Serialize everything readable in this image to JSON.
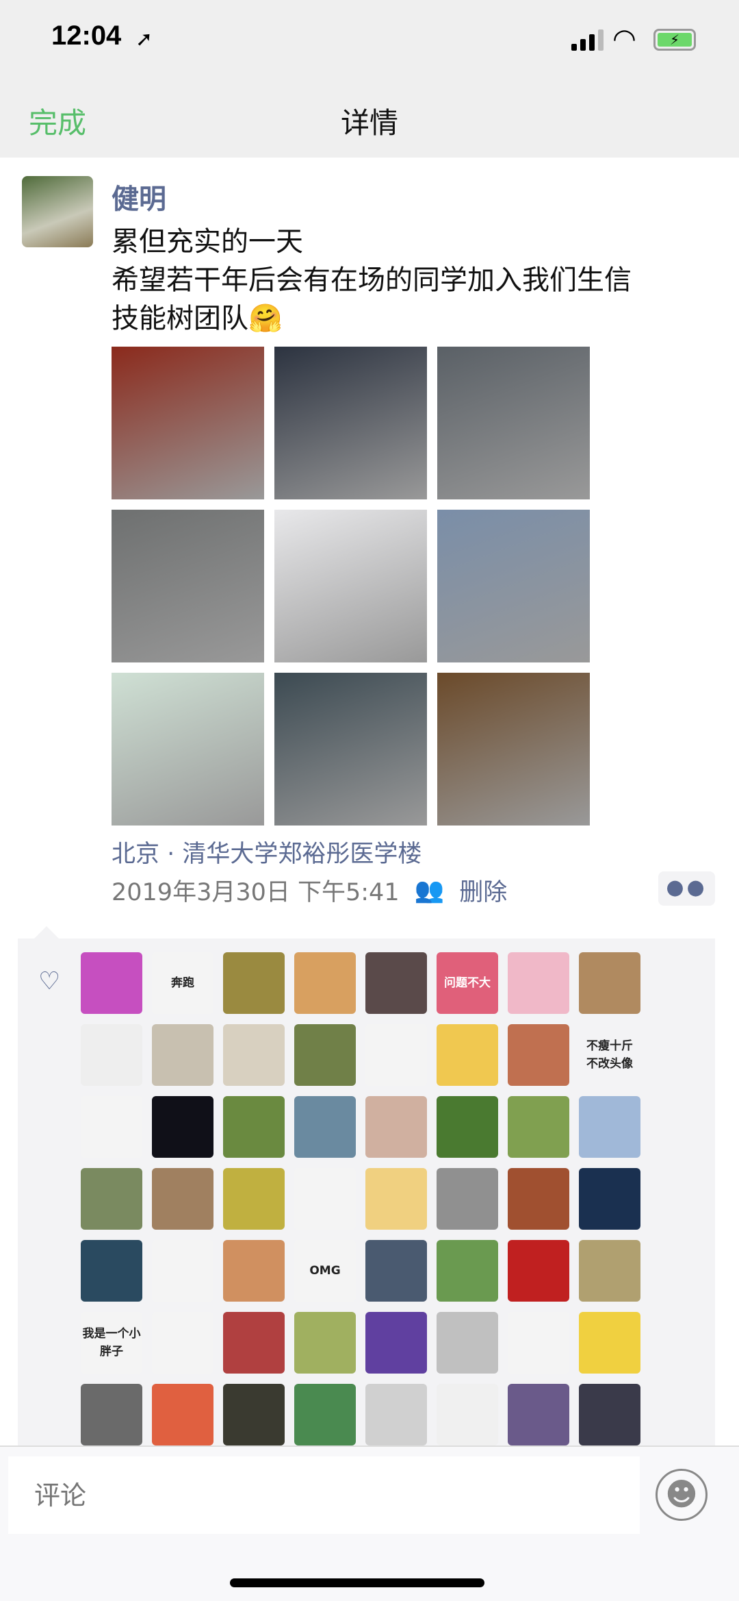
{
  "status_bar": {
    "time": "12:04",
    "location_icon": "location-arrow-icon",
    "wifi_icon": "wifi-icon",
    "battery_icon": "battery-charging-icon"
  },
  "nav": {
    "done_label": "完成",
    "title": "详情",
    "accent": "#57be6a"
  },
  "post": {
    "author": "健明",
    "lines": [
      "累但充实的一天",
      "希望若干年后会有在场的同学加入我们生信",
      "技能树团队🤗"
    ],
    "images": [
      "#8b2a1c",
      "#2c3340",
      "#5a6066",
      "#6e7070",
      "#e8e8ea",
      "#7a8ea8",
      "#cfe0d4",
      "#3c4a52",
      "#6b4a2a"
    ],
    "location": "北京 · 清华大学郑裕彤医学楼",
    "timestamp": "2019年3月30日 下午5:41",
    "delete_label": "删除",
    "link_color": "#5b6a92"
  },
  "likes": {
    "avatars": [
      {
        "c": "#c64fc0"
      },
      {
        "c": "#f4f4f4",
        "t": "奔跑"
      },
      {
        "c": "#9a8a40"
      },
      {
        "c": "#d8a060"
      },
      {
        "c": "#5a4a4a"
      },
      {
        "c": "#e0607a",
        "t": "问题不大"
      },
      {
        "c": "#f0b8c8"
      },
      {
        "c": "#b08a60"
      },
      {
        "c": "#eeeeee"
      },
      {
        "c": "#c8c0b0"
      },
      {
        "c": "#d8d0c0"
      },
      {
        "c": "#708048"
      },
      {
        "c": "#f4f4f4"
      },
      {
        "c": "#f0c850"
      },
      {
        "c": "#c07050"
      },
      {
        "c": "#f3f3f5",
        "t": "不瘦十斤 不改头像"
      },
      {
        "c": "#f4f4f4"
      },
      {
        "c": "#101018"
      },
      {
        "c": "#6a8a40"
      },
      {
        "c": "#6a8aa0"
      },
      {
        "c": "#d0b0a0"
      },
      {
        "c": "#4a7a30"
      },
      {
        "c": "#80a050"
      },
      {
        "c": "#a0b8d8"
      },
      {
        "c": "#7a8a60"
      },
      {
        "c": "#a08060"
      },
      {
        "c": "#c0b040"
      },
      {
        "c": "#f4f4f4"
      },
      {
        "c": "#f0d080"
      },
      {
        "c": "#909090"
      },
      {
        "c": "#a05030"
      },
      {
        "c": "#1a3050"
      },
      {
        "c": "#2a4a60"
      },
      {
        "c": "#f4f4f4"
      },
      {
        "c": "#d09060"
      },
      {
        "c": "#f4f4f4",
        "t": "OMG"
      },
      {
        "c": "#4a5a70"
      },
      {
        "c": "#6a9a50"
      },
      {
        "c": "#c02020"
      },
      {
        "c": "#b0a070"
      },
      {
        "c": "#f4f4f4",
        "t": "我是一个小胖子"
      },
      {
        "c": "#f4f4f4"
      },
      {
        "c": "#b04040"
      },
      {
        "c": "#a0b060"
      },
      {
        "c": "#6040a0"
      },
      {
        "c": "#c0c0c0"
      },
      {
        "c": "#f4f4f4"
      },
      {
        "c": "#f0d040"
      },
      {
        "c": "#6a6a6a"
      },
      {
        "c": "#e06040"
      },
      {
        "c": "#3a3a30"
      },
      {
        "c": "#4a8a50"
      },
      {
        "c": "#d0d0d0"
      },
      {
        "c": "#f0f0f0"
      },
      {
        "c": "#6a5a8a"
      },
      {
        "c": "#3a3a4a"
      }
    ]
  },
  "comment": {
    "placeholder": "评论"
  }
}
